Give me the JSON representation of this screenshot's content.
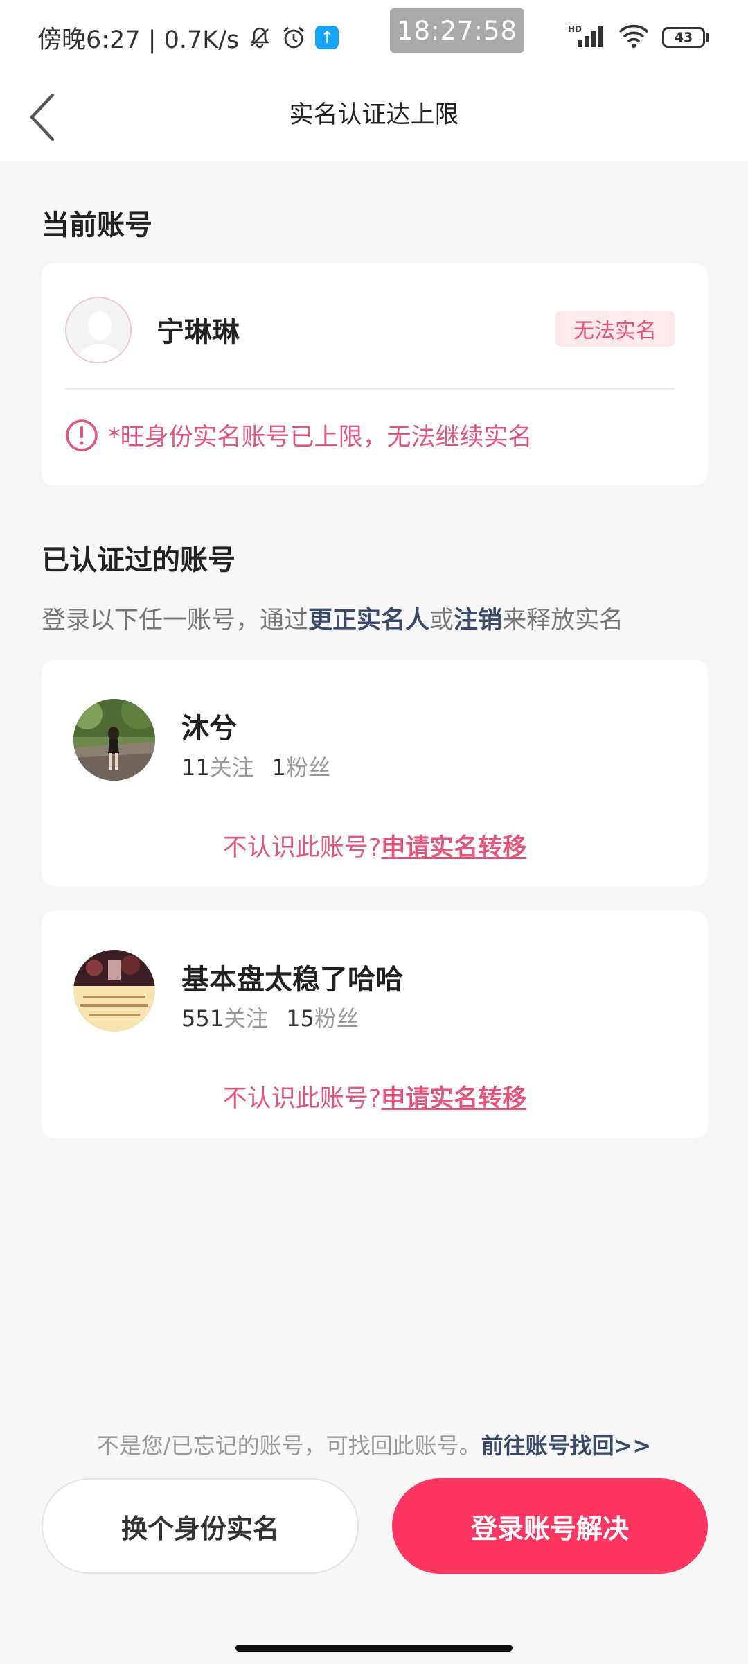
{
  "status_bar": {
    "left_text": "傍晚6:27 | 0.7K/s",
    "clock": "18:27:58",
    "network_label": "HD",
    "battery": "43"
  },
  "header": {
    "title": "实名认证达上限"
  },
  "current_account": {
    "section_title": "当前账号",
    "name": "宁琳琳",
    "badge": "无法实名",
    "warning": "*旺身份实名账号已上限，无法继续实名"
  },
  "verified": {
    "section_title": "已认证过的账号",
    "subtitle_pre": "登录以下任一账号，通过",
    "subtitle_em1": "更正实名人",
    "subtitle_mid": "或",
    "subtitle_em2": "注销",
    "subtitle_post": "来释放实名",
    "accounts": [
      {
        "name": "沐兮",
        "follow_count": "11",
        "follow_label": "关注",
        "fans_count": "1",
        "fans_label": "粉丝",
        "transfer_prefix": "不认识此账号?",
        "transfer_link": "申请实名转移"
      },
      {
        "name": "基本盘太稳了哈哈",
        "follow_count": "551",
        "follow_label": "关注",
        "fans_count": "15",
        "fans_label": "粉丝",
        "transfer_prefix": "不认识此账号?",
        "transfer_link": "申请实名转移"
      }
    ]
  },
  "footer": {
    "recover_text": "不是您/已忘记的账号，可找回此账号。",
    "recover_link": "前往账号找回>>",
    "btn_switch": "换个身份实名",
    "btn_login": "登录账号解决"
  },
  "colors": {
    "accent": "#fe3662",
    "warning": "#e2567a",
    "link_dark": "#3a4a6b",
    "background": "#f7f7f7"
  }
}
